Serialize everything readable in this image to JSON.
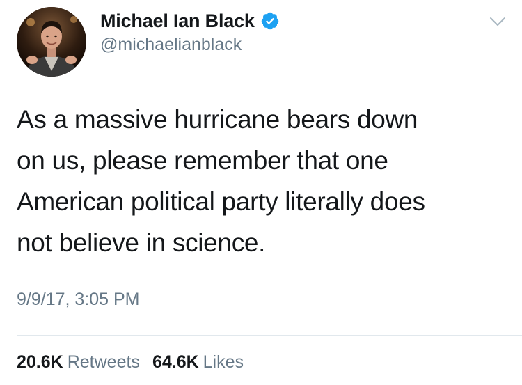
{
  "tweet": {
    "author": {
      "display_name": "Michael Ian Black",
      "handle": "@michaelianblack",
      "verified": true,
      "avatar_icon": "profile-photo",
      "verified_icon": "verified-badge-icon"
    },
    "menu_icon": "chevron-down-icon",
    "text_lines": [
      "As a massive hurricane bears down",
      "on us, please remember that one",
      "American political party literally does",
      "not believe in science."
    ],
    "timestamp": "9/9/17, 3:05 PM",
    "stats": {
      "retweets_count": "20.6K",
      "retweets_label": "Retweets",
      "likes_count": "64.6K",
      "likes_label": "Likes"
    }
  },
  "colors": {
    "text_primary": "#14171a",
    "text_secondary": "#657786",
    "verified_blue": "#1da1f2",
    "divider": "#e1e8ed",
    "chevron": "#aab8c2"
  }
}
